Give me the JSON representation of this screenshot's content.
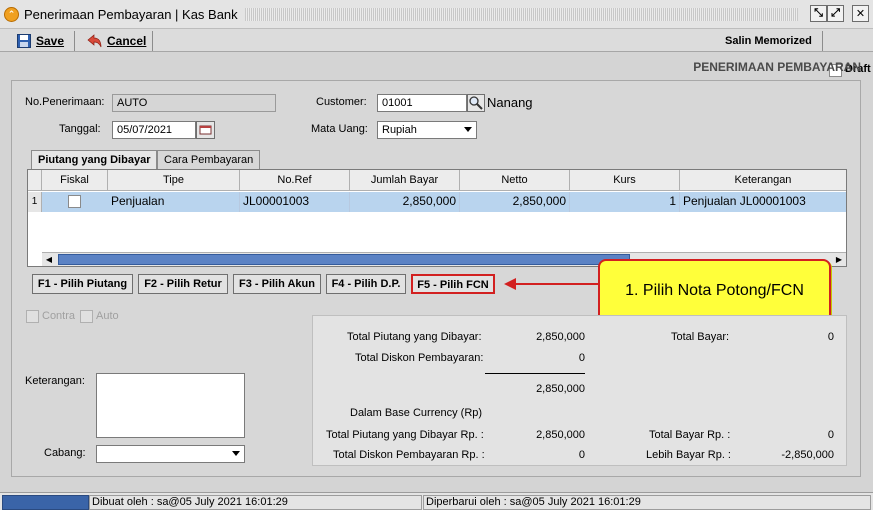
{
  "window": {
    "title": "Penerimaan Pembayaran | Kas Bank",
    "app_icon": "currency-icon"
  },
  "toolbar": {
    "save_label": "Save",
    "cancel_label": "Cancel",
    "salin_memorized_label": "Salin Memorized",
    "draft_label": "Draft"
  },
  "header": {
    "label": "PENERIMAAN PEMBAYARAN"
  },
  "form": {
    "no_penerimaan_label": "No.Penerimaan:",
    "no_penerimaan_value": "AUTO",
    "tanggal_label": "Tanggal:",
    "tanggal_value": "05/07/2021",
    "customer_label": "Customer:",
    "customer_value": "01001",
    "customer_name": "Nanang",
    "mata_uang_label": "Mata Uang:",
    "mata_uang_value": "Rupiah"
  },
  "tabs": [
    {
      "label": "Piutang yang Dibayar",
      "active": true
    },
    {
      "label": "Cara Pembayaran",
      "active": false
    }
  ],
  "grid": {
    "columns": [
      "Fiskal",
      "Tipe",
      "No.Ref",
      "Jumlah Bayar",
      "Netto",
      "Kurs",
      "Keterangan"
    ],
    "rows": [
      {
        "num": "1",
        "fiskal": false,
        "tipe": "Penjualan",
        "no_ref": "JL00001003",
        "jumlah_bayar": "2,850,000",
        "netto": "2,850,000",
        "kurs": "1",
        "keterangan": "Penjualan JL00001003"
      }
    ]
  },
  "function_buttons": [
    "F1 - Pilih Piutang",
    "F2 - Pilih Retur",
    "F3 - Pilih Akun",
    "F4 - Pilih D.P.",
    "F5 - Pilih FCN"
  ],
  "callout": {
    "text": "1. Pilih Nota Potong/FCN",
    "color": "#ffff3a",
    "border_color": "#d22020"
  },
  "options": {
    "contra_label": "Contra",
    "auto_label": "Auto"
  },
  "notes": {
    "keterangan_label": "Keterangan:",
    "cabang_label": "Cabang:"
  },
  "summary": {
    "total_piutang_label": "Total Piutang yang Dibayar:",
    "total_piutang_value": "2,850,000",
    "total_diskon_label": "Total Diskon Pembayaran:",
    "total_diskon_value": "0",
    "subtotal_value": "2,850,000",
    "base_currency_label": "Dalam Base Currency (Rp)",
    "total_piutang_rp_label": "Total Piutang yang Dibayar Rp. :",
    "total_piutang_rp_value": "2,850,000",
    "total_diskon_rp_label": "Total Diskon Pembayaran Rp. :",
    "total_diskon_rp_value": "0",
    "total_bayar_label": "Total Bayar:",
    "total_bayar_value": "0",
    "total_bayar_rp_label": "Total Bayar Rp. :",
    "total_bayar_rp_value": "0",
    "lebih_bayar_rp_label": "Lebih Bayar Rp. :",
    "lebih_bayar_rp_value": "-2,850,000"
  },
  "status_bar": {
    "dibuat": "Dibuat oleh : sa@05 July 2021  16:01:29",
    "diperbarui": "Diperbarui oleh : sa@05 July 2021  16:01:29"
  }
}
